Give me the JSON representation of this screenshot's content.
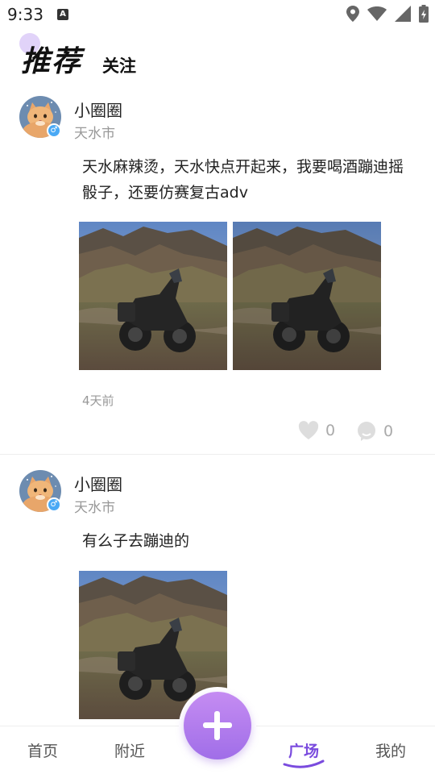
{
  "status_bar": {
    "time": "9:33",
    "notification_icon": "A"
  },
  "header": {
    "tab_recommend": "推荐",
    "tab_follow": "关注"
  },
  "posts": [
    {
      "username": "小圈圈",
      "city": "天水市",
      "content": "天水麻辣烫，天水快点开起来，我要喝酒蹦迪摇骰子，还要仿赛复古adv",
      "time_ago": "4天前",
      "likes": "0",
      "comments": "0",
      "photos": 2
    },
    {
      "username": "小圈圈",
      "city": "天水市",
      "content": "有么子去蹦迪的",
      "photos": 1
    }
  ],
  "bottom_nav": {
    "home": "首页",
    "nearby": "附近",
    "square": "广场",
    "mine": "我的"
  },
  "colors": {
    "accent": "#7a4bde",
    "fab": "#b07cec",
    "gender_badge": "#4aa9f5"
  }
}
